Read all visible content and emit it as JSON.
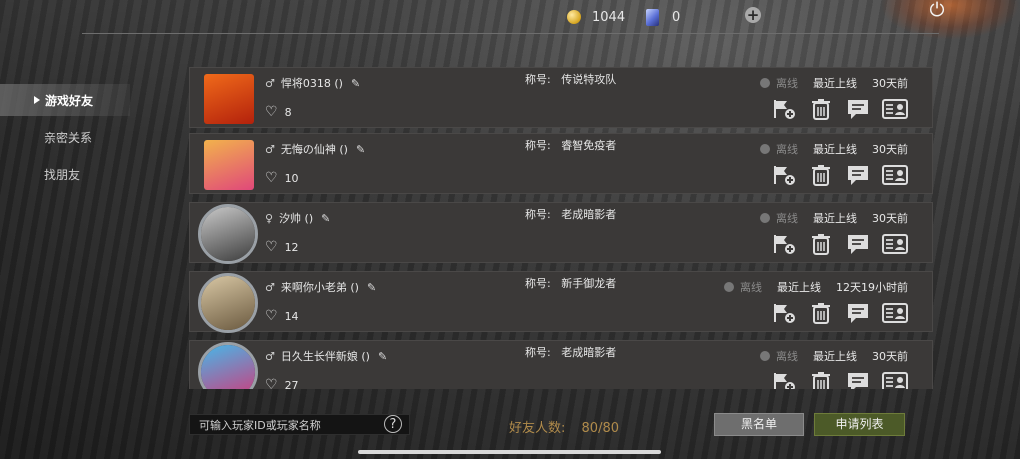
{
  "currency": {
    "coins": "1044",
    "cards": "0"
  },
  "icons": {
    "coin": "coin-icon",
    "card": "card-icon",
    "add": "plus-icon",
    "power": "power-icon"
  },
  "sidebar": {
    "items": [
      {
        "label": "游戏好友",
        "active": true
      },
      {
        "label": "亲密关系",
        "active": false
      },
      {
        "label": "找朋友",
        "active": false
      }
    ]
  },
  "common": {
    "title_label": "称号:",
    "offline_label": "离线",
    "last_online_label": "最近上线"
  },
  "friends": [
    {
      "name": "悍将0318 ()",
      "gender": "♂",
      "hearts": "8",
      "title": "传说特攻队",
      "last_online": "30天前",
      "avatar_colors": [
        "#f06a1a",
        "#b3210c"
      ]
    },
    {
      "name": "无悔の仙神 ()",
      "gender": "♂",
      "hearts": "10",
      "title": "睿智免疫者",
      "last_online": "30天前",
      "avatar_colors": [
        "#f2b24c",
        "#e0487a"
      ]
    },
    {
      "name": "汐帅 ()",
      "gender": "♀",
      "hearts": "12",
      "title": "老成暗影者",
      "last_online": "30天前",
      "avatar_colors": [
        "#c9c9c9",
        "#3d3d3d"
      ]
    },
    {
      "name": "来啊你小老弟 ()",
      "gender": "♂",
      "hearts": "14",
      "title": "新手御龙者",
      "last_online": "12天19小时前",
      "avatar_colors": [
        "#d8c7a4",
        "#6b5a40"
      ]
    },
    {
      "name": "日久生长伴新娘 ()",
      "gender": "♂",
      "hearts": "27",
      "title": "老成暗影者",
      "last_online": "30天前",
      "avatar_colors": [
        "#47b7e8",
        "#d03a7a"
      ]
    }
  ],
  "footer": {
    "search_placeholder": "可输入玩家ID或玩家名称",
    "friend_count_label": "好友人数:",
    "friend_count_value": "80/80",
    "blacklist_label": "黑名单",
    "apply_list_label": "申请列表"
  }
}
